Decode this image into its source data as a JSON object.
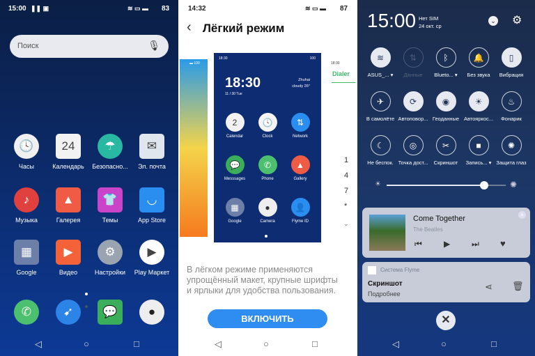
{
  "home": {
    "status": {
      "time": "15:00",
      "battery": "83"
    },
    "search": {
      "placeholder": "Поиск",
      "icon": "mic-icon"
    },
    "apps": [
      {
        "label": "Часы",
        "icon": "clock-icon",
        "color": "#f0f0f0",
        "glyph": "🕓"
      },
      {
        "label": "Календарь",
        "icon": "calendar-icon",
        "color": "#f2f2f2",
        "glyph": "24",
        "sub": "Ср"
      },
      {
        "label": "Безопасно...",
        "icon": "umbrella-icon",
        "color": "#29b8a2",
        "glyph": "☂"
      },
      {
        "label": "Эл. почта",
        "icon": "mail-icon",
        "color": "#dfe6ee",
        "glyph": "✉"
      },
      {
        "label": "Музыка",
        "icon": "music-icon",
        "color": "#e0413e",
        "glyph": "♪"
      },
      {
        "label": "Галерея",
        "icon": "gallery-icon",
        "color": "#ef5b45",
        "glyph": "▲"
      },
      {
        "label": "Темы",
        "icon": "themes-icon",
        "color": "#c944c8",
        "glyph": "👕"
      },
      {
        "label": "App Store",
        "icon": "store-icon",
        "color": "#2a8ef0",
        "glyph": "◡"
      },
      {
        "label": "Google",
        "icon": "folder-icon",
        "color": "#6b7fa8",
        "glyph": "▦"
      },
      {
        "label": "Видео",
        "icon": "video-icon",
        "color": "#f4623a",
        "glyph": "▶"
      },
      {
        "label": "Настройки",
        "icon": "settings-icon",
        "color": "#9aa3b0",
        "glyph": "⚙"
      },
      {
        "label": "Play Маркет",
        "icon": "play-store-icon",
        "color": "#ffffff",
        "glyph": "▶"
      }
    ],
    "dock": [
      {
        "icon": "phone-icon",
        "color": "#4cc06e",
        "glyph": "✆"
      },
      {
        "icon": "browser-compass-icon",
        "color": "#2b84e6",
        "glyph": "➹"
      },
      {
        "icon": "messages-icon",
        "color": "#3aae5a",
        "glyph": "💬"
      },
      {
        "icon": "camera-icon",
        "color": "#eeeeee",
        "glyph": "●"
      }
    ]
  },
  "easy": {
    "status": {
      "time": "14:32",
      "battery": "87"
    },
    "title": "Лёгкий режим",
    "preview": {
      "time": "18:30",
      "date": "11 / 30  Tue",
      "city": "Zhuhai",
      "weather": "cloudy  26°",
      "status_time": "18:30",
      "battery": "100",
      "apps": [
        {
          "label": "Calendar",
          "color": "#f2f2f2",
          "glyph": "2"
        },
        {
          "label": "Clock",
          "color": "#f4f4f4",
          "glyph": "🕓"
        },
        {
          "label": "Network",
          "color": "#2a8ef0",
          "glyph": "⇅"
        },
        {
          "label": "Messsages",
          "color": "#3aae5a",
          "glyph": "💬"
        },
        {
          "label": "Phone",
          "color": "#4cc06e",
          "glyph": "✆"
        },
        {
          "label": "Gallery",
          "color": "#ef5b45",
          "glyph": "▲"
        },
        {
          "label": "Google",
          "color": "#6b7fa8",
          "glyph": "▦"
        },
        {
          "label": "Camera",
          "color": "#eeeeee",
          "glyph": "●"
        },
        {
          "label": "Flyme ID",
          "color": "#2a8ef0",
          "glyph": "👤"
        }
      ],
      "dialer_label": "Dialer",
      "dialer_time": "18:30",
      "keys": [
        "1",
        "4",
        "7",
        "*"
      ]
    },
    "description": "В лёгком режиме применяются упрощённый макет, крупные шрифты и ярлыки для удобства пользования.",
    "enable_button": "ВКЛЮЧИТЬ",
    "accent": "#2f8cf0"
  },
  "shade": {
    "time": "15:00",
    "sim": "Нет SIM",
    "date": "24 окт. ср",
    "tiles": [
      {
        "label": "ASUS_...",
        "icon": "wifi-icon",
        "glyph": "≋",
        "on": true,
        "arrow": true
      },
      {
        "label": "Данные",
        "icon": "mobile-data-icon",
        "glyph": "⇅",
        "dim": true
      },
      {
        "label": "Blueto...",
        "icon": "bluetooth-icon",
        "glyph": "ᛒ",
        "arrow": true
      },
      {
        "label": "Без звука",
        "icon": "bell-icon",
        "glyph": "🔔"
      },
      {
        "label": "Вибрация",
        "icon": "vibration-icon",
        "glyph": "▯",
        "on": true
      },
      {
        "label": "В самолёте",
        "icon": "airplane-icon",
        "glyph": "✈"
      },
      {
        "label": "Автоповор...",
        "icon": "rotate-icon",
        "glyph": "⟳",
        "on": true
      },
      {
        "label": "Геоданные",
        "icon": "location-icon",
        "glyph": "◉",
        "on": true
      },
      {
        "label": "Автояркос...",
        "icon": "auto-brightness-icon",
        "glyph": "☀",
        "on": true
      },
      {
        "label": "Фонарик",
        "icon": "flashlight-icon",
        "glyph": "♨"
      },
      {
        "label": "Не беспок.",
        "icon": "moon-icon",
        "glyph": "☾"
      },
      {
        "label": "Точка дост...",
        "icon": "hotspot-icon",
        "glyph": "◎"
      },
      {
        "label": "Скриншот",
        "icon": "scissors-icon",
        "glyph": "✂"
      },
      {
        "label": "Запись...",
        "icon": "screen-record-icon",
        "glyph": "■",
        "arrow": true
      },
      {
        "label": "Защита глаз",
        "icon": "eye-protect-icon",
        "glyph": "✺"
      }
    ],
    "brightness": 0.82,
    "music": {
      "title": "Come Together",
      "artist": "The Beatles"
    },
    "notification": {
      "app": "Система Flyme",
      "title": "Скриншот",
      "subtitle": "Подробнее"
    }
  }
}
